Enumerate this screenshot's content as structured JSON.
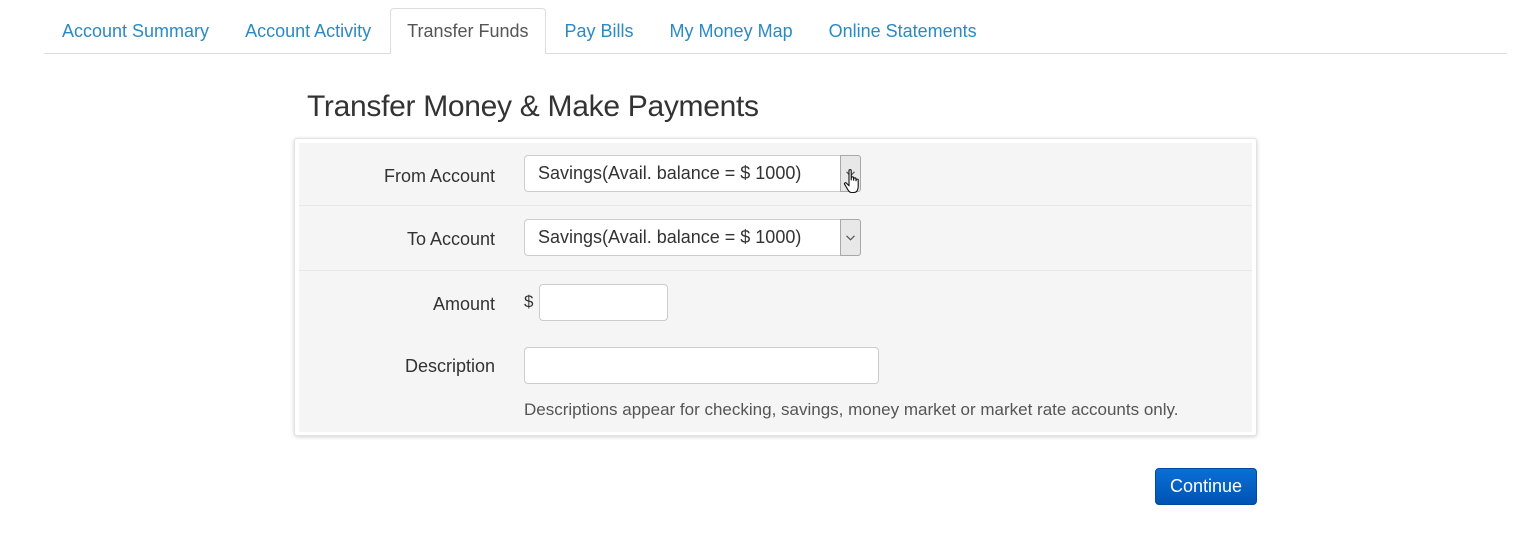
{
  "tabs": [
    {
      "label": "Account Summary",
      "active": false
    },
    {
      "label": "Account Activity",
      "active": false
    },
    {
      "label": "Transfer Funds",
      "active": true
    },
    {
      "label": "Pay Bills",
      "active": false
    },
    {
      "label": "My Money Map",
      "active": false
    },
    {
      "label": "Online Statements",
      "active": false
    }
  ],
  "page_title": "Transfer Money & Make Payments",
  "form": {
    "from_account": {
      "label": "From Account",
      "selected": "Savings(Avail. balance = $ 1000)"
    },
    "to_account": {
      "label": "To Account",
      "selected": "Savings(Avail. balance = $ 1000)"
    },
    "amount": {
      "label": "Amount",
      "currency_symbol": "$",
      "value": ""
    },
    "description": {
      "label": "Description",
      "value": "",
      "help_text": "Descriptions appear for checking, savings, money market or market rate accounts only."
    }
  },
  "continue_label": "Continue",
  "colors": {
    "tab_link": "#2a8ac4",
    "button_primary": "#0a6fd6",
    "panel_background": "#f5f5f5"
  }
}
